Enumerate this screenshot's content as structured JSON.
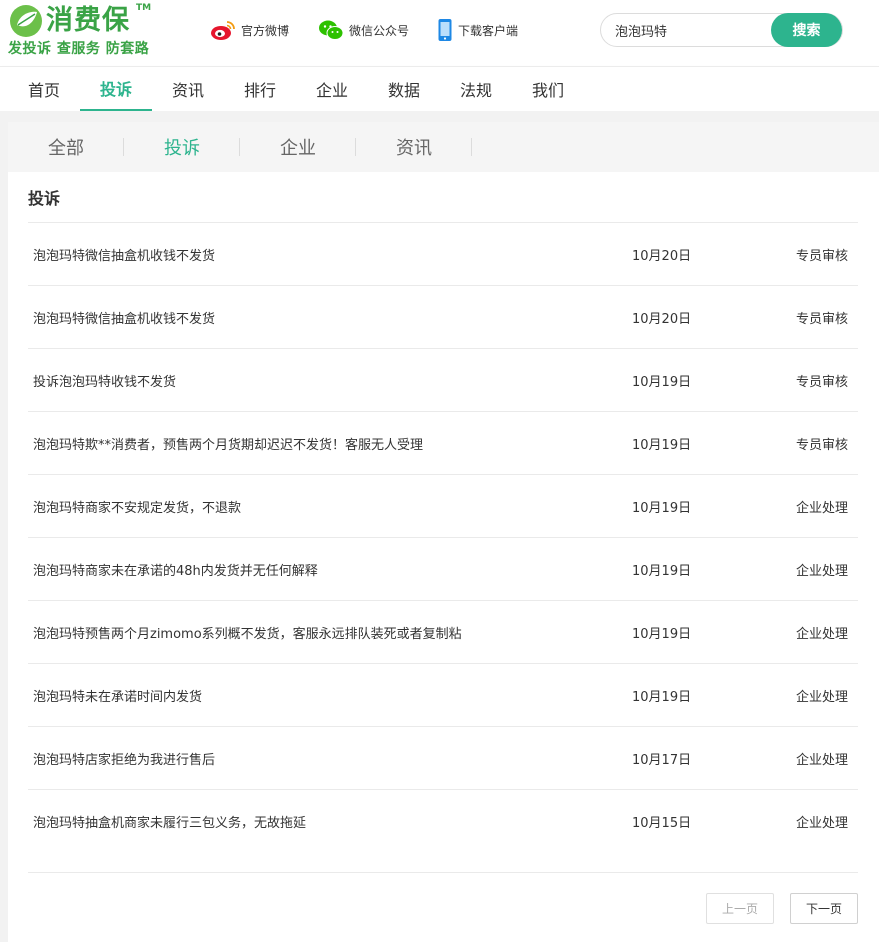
{
  "brand": {
    "name": "消费保",
    "tm": "TM",
    "slogan": "发投诉 查服务 防套路",
    "color": "#3aa346"
  },
  "header_links": {
    "weibo": "官方微博",
    "wechat": "微信公众号",
    "app": "下载客户端"
  },
  "search": {
    "value": "泡泡玛特",
    "button": "搜索",
    "accent": "#2db48e"
  },
  "nav": {
    "items": [
      "首页",
      "投诉",
      "资讯",
      "排行",
      "企业",
      "数据",
      "法规",
      "我们"
    ],
    "active": "投诉"
  },
  "tabs": {
    "items": [
      "全部",
      "投诉",
      "企业",
      "资讯"
    ],
    "active": "投诉"
  },
  "section": {
    "title": "投诉"
  },
  "complaints": [
    {
      "title": "泡泡玛特微信抽盒机收钱不发货",
      "date": "10月20日",
      "status": "专员审核"
    },
    {
      "title": "泡泡玛特微信抽盒机收钱不发货",
      "date": "10月20日",
      "status": "专员审核"
    },
    {
      "title": "投诉泡泡玛特收钱不发货",
      "date": "10月19日",
      "status": "专员审核"
    },
    {
      "title": "泡泡玛特欺**消费者，预售两个月货期却迟迟不发货！客服无人受理",
      "date": "10月19日",
      "status": "专员审核"
    },
    {
      "title": "泡泡玛特商家不安规定发货，不退款",
      "date": "10月19日",
      "status": "企业处理"
    },
    {
      "title": "泡泡玛特商家未在承诺的48h内发货并无任何解释",
      "date": "10月19日",
      "status": "企业处理"
    },
    {
      "title": "泡泡玛特预售两个月zimomo系列概不发货，客服永远排队装死或者复制粘",
      "date": "10月19日",
      "status": "企业处理"
    },
    {
      "title": "泡泡玛特未在承诺时间内发货",
      "date": "10月19日",
      "status": "企业处理"
    },
    {
      "title": "泡泡玛特店家拒绝为我进行售后",
      "date": "10月17日",
      "status": "企业处理"
    },
    {
      "title": "泡泡玛特抽盒机商家未履行三包义务，无故拖延",
      "date": "10月15日",
      "status": "企业处理"
    }
  ],
  "pagination": {
    "prev": "上一页",
    "next": "下一页"
  },
  "icons": {
    "weibo": "weibo-icon",
    "wechat": "wechat-icon",
    "app": "phone-icon",
    "logo": "leaf-logo-icon"
  }
}
